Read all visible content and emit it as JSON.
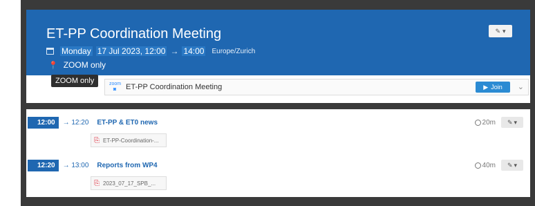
{
  "event": {
    "title": "ET-PP Coordination Meeting",
    "day": "Monday",
    "date": "17 Jul 2023, 12:00",
    "arrow": "→",
    "end_time": "14:00",
    "timezone": "Europe/Zurich",
    "location": "ZOOM only"
  },
  "tooltip": "ZOOM only",
  "video": {
    "logo": "zoom",
    "label": "ET-PP Coordination Meeting",
    "join_label": "Join"
  },
  "contributions": [
    {
      "start": "12:00",
      "end": "→ 12:20",
      "title": "ET-PP & ET0 news",
      "duration": "20m",
      "attachment": "ET-PP-Coordination-..."
    },
    {
      "start": "12:20",
      "end": "→ 13:00",
      "title": "Reports from WP4",
      "duration": "40m",
      "attachment": "2023_07_17_SPB_..."
    }
  ],
  "icons": {
    "calendar": "calendar-icon",
    "pin": "location-pin-icon",
    "edit": "edit-icon",
    "pdf": "pdf-icon",
    "clock": "clock-icon"
  },
  "colors": {
    "header": "#1f67b1",
    "join": "#2b8bd3"
  }
}
